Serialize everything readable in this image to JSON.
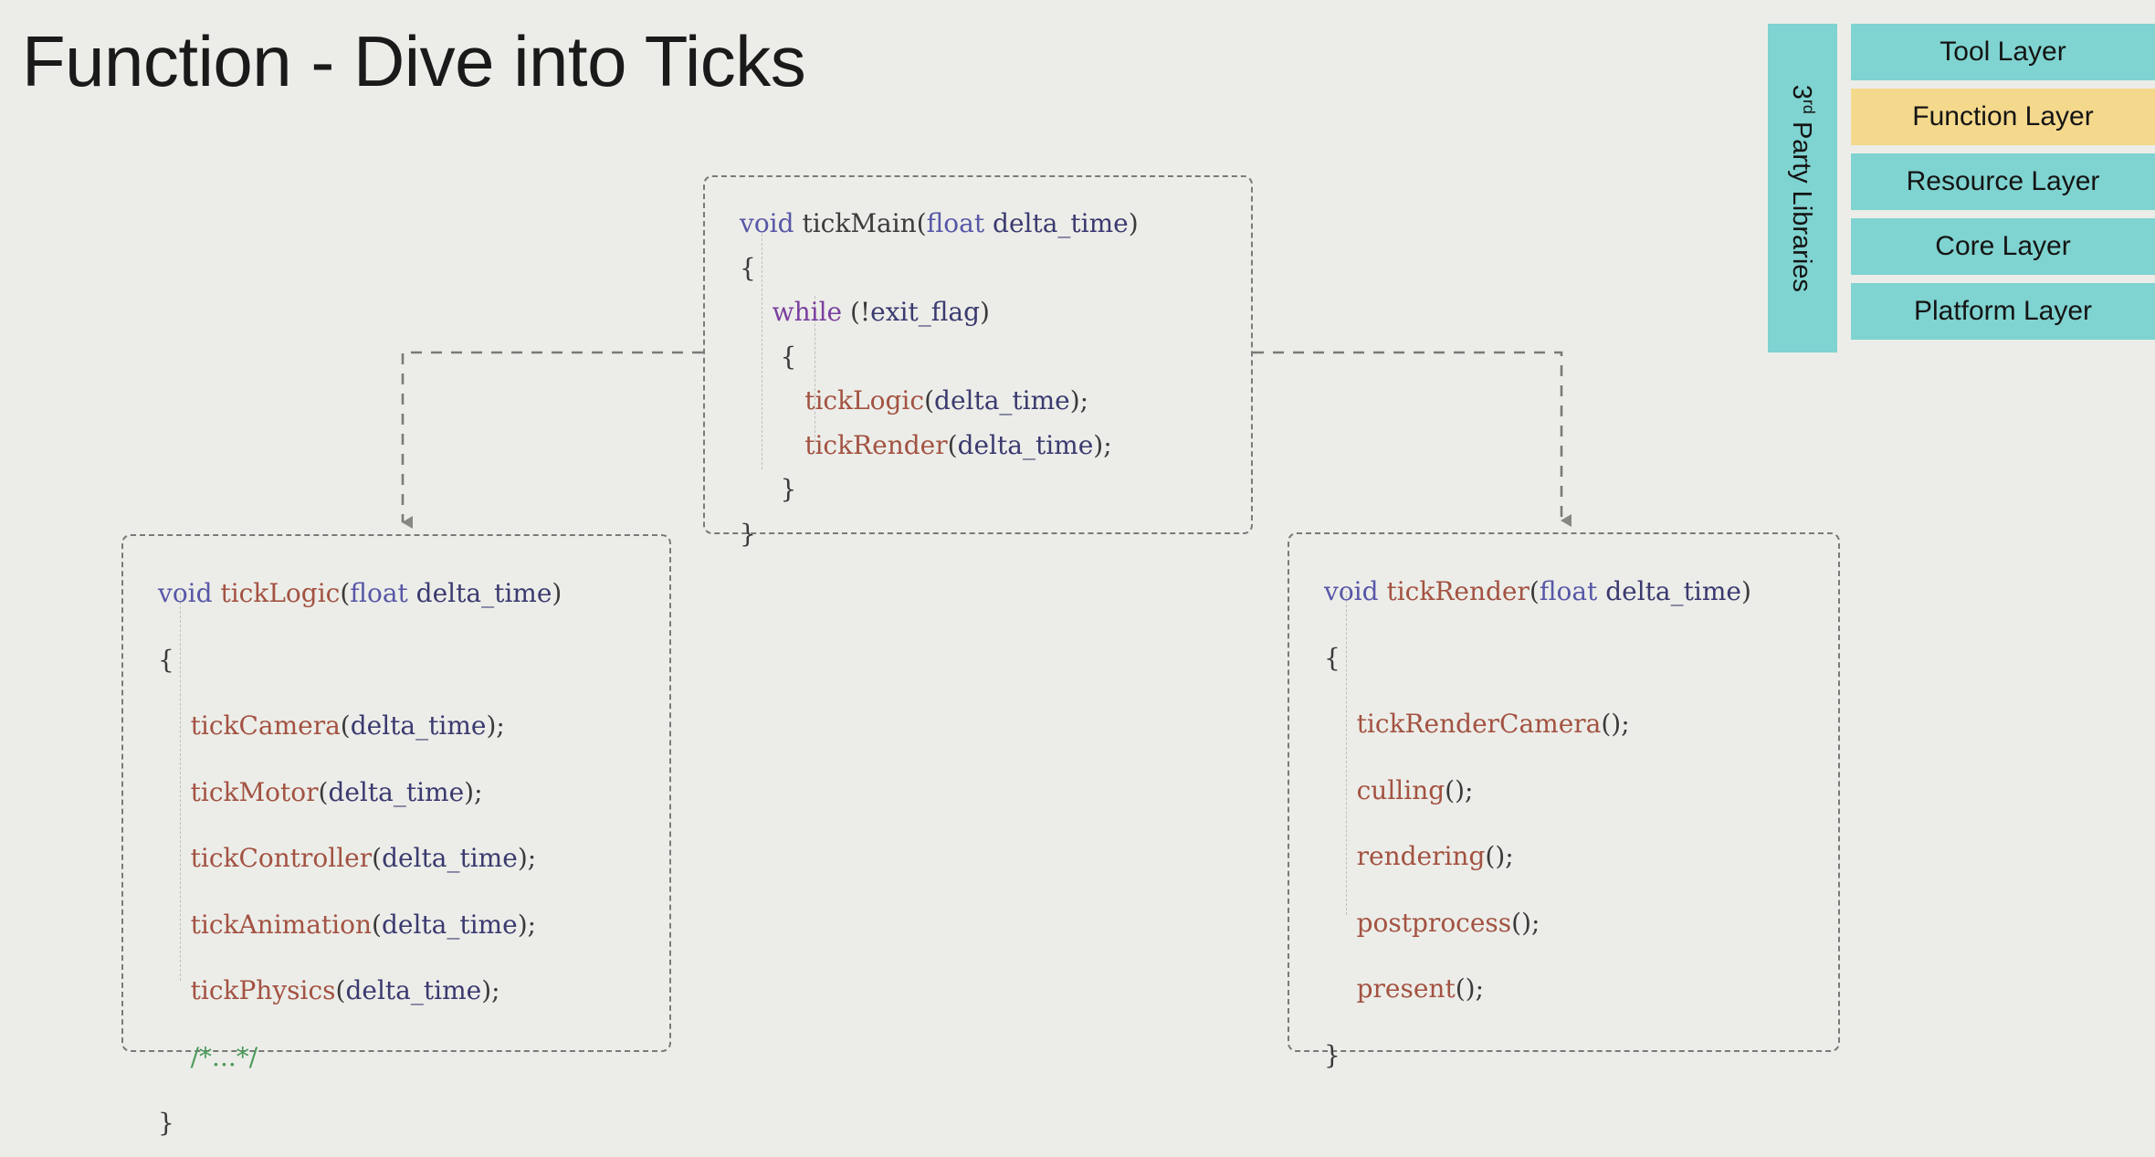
{
  "slide": {
    "title": "Function - Dive into Ticks",
    "background_color": "#ECEDE8"
  },
  "colors": {
    "background": "#ECEDE8",
    "teal": "#7FD3D0",
    "highlight_yellow": "#F4D88C",
    "dashed_border": "#7A7A78",
    "keyword": "#5757A8",
    "control": "#7B3FA0",
    "function": "#A35242",
    "variable": "#3A3A70",
    "comment": "#4C9A5B",
    "punctuation": "#3A3A3A"
  },
  "code_blocks": [
    {
      "id": "tick-main",
      "name": "tickMain",
      "lines": [
        [
          {
            "t": "void",
            "c": "t-kw"
          },
          {
            "t": " ",
            "c": "t-pun"
          },
          {
            "t": "tickMain",
            "c": "t-fnname"
          },
          {
            "t": "(",
            "c": "t-pun"
          },
          {
            "t": "float",
            "c": "t-kw"
          },
          {
            "t": " ",
            "c": "t-pun"
          },
          {
            "t": "delta_time",
            "c": "t-var"
          },
          {
            "t": ")",
            "c": "t-pun"
          }
        ],
        [
          {
            "t": "{",
            "c": "t-pun"
          }
        ],
        [
          {
            "t": "    ",
            "c": "t-pun"
          },
          {
            "t": "while",
            "c": "t-ctrl"
          },
          {
            "t": " (!",
            "c": "t-pun"
          },
          {
            "t": "exit_flag",
            "c": "t-var"
          },
          {
            "t": ")",
            "c": "t-pun"
          }
        ],
        [
          {
            "t": "     {",
            "c": "t-pun"
          }
        ],
        [
          {
            "t": "        ",
            "c": "t-pun"
          },
          {
            "t": "tickLogic",
            "c": "t-fn"
          },
          {
            "t": "(",
            "c": "t-pun"
          },
          {
            "t": "delta_time",
            "c": "t-var"
          },
          {
            "t": ");",
            "c": "t-pun"
          }
        ],
        [
          {
            "t": "        ",
            "c": "t-pun"
          },
          {
            "t": "tickRender",
            "c": "t-fn"
          },
          {
            "t": "(",
            "c": "t-pun"
          },
          {
            "t": "delta_time",
            "c": "t-var"
          },
          {
            "t": ");",
            "c": "t-pun"
          }
        ],
        [
          {
            "t": "     }",
            "c": "t-pun"
          }
        ],
        [
          {
            "t": "}",
            "c": "t-pun"
          }
        ]
      ]
    },
    {
      "id": "tick-logic",
      "name": "tickLogic",
      "lines": [
        [
          {
            "t": "void",
            "c": "t-kw"
          },
          {
            "t": " ",
            "c": "t-pun"
          },
          {
            "t": "tickLogic",
            "c": "t-fn"
          },
          {
            "t": "(",
            "c": "t-pun"
          },
          {
            "t": "float",
            "c": "t-kw"
          },
          {
            "t": " ",
            "c": "t-pun"
          },
          {
            "t": "delta_time",
            "c": "t-var"
          },
          {
            "t": ")",
            "c": "t-pun"
          }
        ],
        [
          {
            "t": "{",
            "c": "t-pun"
          }
        ],
        [
          {
            "t": "    ",
            "c": "t-pun"
          },
          {
            "t": "tickCamera",
            "c": "t-fn"
          },
          {
            "t": "(",
            "c": "t-pun"
          },
          {
            "t": "delta_time",
            "c": "t-var"
          },
          {
            "t": ");",
            "c": "t-pun"
          }
        ],
        [
          {
            "t": "    ",
            "c": "t-pun"
          },
          {
            "t": "tickMotor",
            "c": "t-fn"
          },
          {
            "t": "(",
            "c": "t-pun"
          },
          {
            "t": "delta_time",
            "c": "t-var"
          },
          {
            "t": ");",
            "c": "t-pun"
          }
        ],
        [
          {
            "t": "    ",
            "c": "t-pun"
          },
          {
            "t": "tickController",
            "c": "t-fn"
          },
          {
            "t": "(",
            "c": "t-pun"
          },
          {
            "t": "delta_time",
            "c": "t-var"
          },
          {
            "t": ");",
            "c": "t-pun"
          }
        ],
        [
          {
            "t": "    ",
            "c": "t-pun"
          },
          {
            "t": "tickAnimation",
            "c": "t-fn"
          },
          {
            "t": "(",
            "c": "t-pun"
          },
          {
            "t": "delta_time",
            "c": "t-var"
          },
          {
            "t": ");",
            "c": "t-pun"
          }
        ],
        [
          {
            "t": "    ",
            "c": "t-pun"
          },
          {
            "t": "tickPhysics",
            "c": "t-fn"
          },
          {
            "t": "(",
            "c": "t-pun"
          },
          {
            "t": "delta_time",
            "c": "t-var"
          },
          {
            "t": ");",
            "c": "t-pun"
          }
        ],
        [
          {
            "t": "    ",
            "c": "t-pun"
          },
          {
            "t": "/*...*/",
            "c": "t-cmt"
          }
        ],
        [
          {
            "t": "}",
            "c": "t-pun"
          }
        ]
      ]
    },
    {
      "id": "tick-render",
      "name": "tickRender",
      "lines": [
        [
          {
            "t": "void",
            "c": "t-kw"
          },
          {
            "t": " ",
            "c": "t-pun"
          },
          {
            "t": "tickRender",
            "c": "t-fn"
          },
          {
            "t": "(",
            "c": "t-pun"
          },
          {
            "t": "float",
            "c": "t-kw"
          },
          {
            "t": " ",
            "c": "t-pun"
          },
          {
            "t": "delta_time",
            "c": "t-var"
          },
          {
            "t": ")",
            "c": "t-pun"
          }
        ],
        [
          {
            "t": "{",
            "c": "t-pun"
          }
        ],
        [
          {
            "t": "    ",
            "c": "t-pun"
          },
          {
            "t": "tickRenderCamera",
            "c": "t-fn"
          },
          {
            "t": "();",
            "c": "t-pun"
          }
        ],
        [
          {
            "t": "    ",
            "c": "t-pun"
          },
          {
            "t": "culling",
            "c": "t-fn"
          },
          {
            "t": "();",
            "c": "t-pun"
          }
        ],
        [
          {
            "t": "    ",
            "c": "t-pun"
          },
          {
            "t": "rendering",
            "c": "t-fn"
          },
          {
            "t": "();",
            "c": "t-pun"
          }
        ],
        [
          {
            "t": "    ",
            "c": "t-pun"
          },
          {
            "t": "postprocess",
            "c": "t-fn"
          },
          {
            "t": "();",
            "c": "t-pun"
          }
        ],
        [
          {
            "t": "    ",
            "c": "t-pun"
          },
          {
            "t": "present",
            "c": "t-fn"
          },
          {
            "t": "();",
            "c": "t-pun"
          }
        ],
        [
          {
            "t": "}",
            "c": "t-pun"
          }
        ]
      ]
    }
  ],
  "architecture_panel": {
    "sidebar_label_main": "3",
    "sidebar_label_sup": "rd",
    "sidebar_label_rest": " Party Libraries",
    "layers": [
      {
        "label": "Tool Layer",
        "style": "teal"
      },
      {
        "label": "Function Layer",
        "style": "highlight"
      },
      {
        "label": "Resource Layer",
        "style": "teal"
      },
      {
        "label": "Core Layer",
        "style": "teal"
      },
      {
        "label": "Platform Layer",
        "style": "teal"
      }
    ]
  }
}
